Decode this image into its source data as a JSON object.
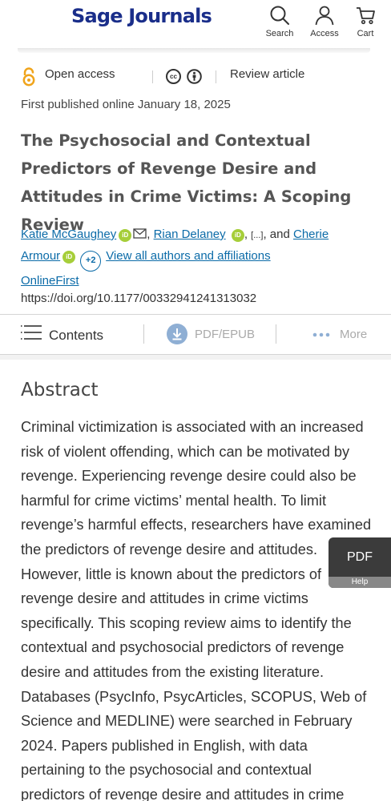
{
  "header": {
    "logo": "Sage Journals",
    "search_label": "Search",
    "access_label": "Access",
    "cart_label": "Cart"
  },
  "meta": {
    "open_access": "Open access",
    "cc_label": "cc",
    "article_type": "Review article"
  },
  "published": "First published online January 18, 2025",
  "title": "The Psychosocial and Contextual Predictors of Revenge Desire and Attitudes in Crime Victims: A Scoping Review",
  "authors": {
    "author1": "Katie McGaughey",
    "author2": "Rian Delaney",
    "ellipsis": "[...]",
    "and": "and",
    "author3_part1": "Cherie",
    "author3_part2": "Armour",
    "orcid_label": "iD",
    "more_count": "+2",
    "view_all": "View all authors and affiliations"
  },
  "online_first": "OnlineFirst",
  "doi": "https://doi.org/10.1177/00332941241313032",
  "toolbar": {
    "contents": "Contents",
    "pdf_epub": "PDF/EPUB",
    "more": "More"
  },
  "abstract": {
    "heading": "Abstract",
    "text": "Criminal victimization is associated with an increased risk of violent offending, which can be motivated by revenge. Experiencing revenge desire could also be harmful for crime victims’ mental health. To limit revenge’s harmful effects, researchers have examined the predictors of revenge desire and attitudes. However, little is known about the predictors of revenge desire and attitudes in crime victims specifically. This scoping review aims to identify the contextual and psychosocial predictors of revenge desire and attitudes from the existing literature. Databases (PsycInfo, PsycArticles, SCOPUS, Web of Science and MEDLINE) were searched in February 2024. Papers published in English, with data pertaining to the psychosocial and contextual predictors of revenge desire and attitudes in crime"
  },
  "pdf_float": {
    "label": "PDF",
    "help": "Help"
  },
  "colors": {
    "brand": "#1a2e8a",
    "link": "#0b6ba8",
    "open_access": "#f0a41b",
    "orcid": "#a6ce39"
  }
}
